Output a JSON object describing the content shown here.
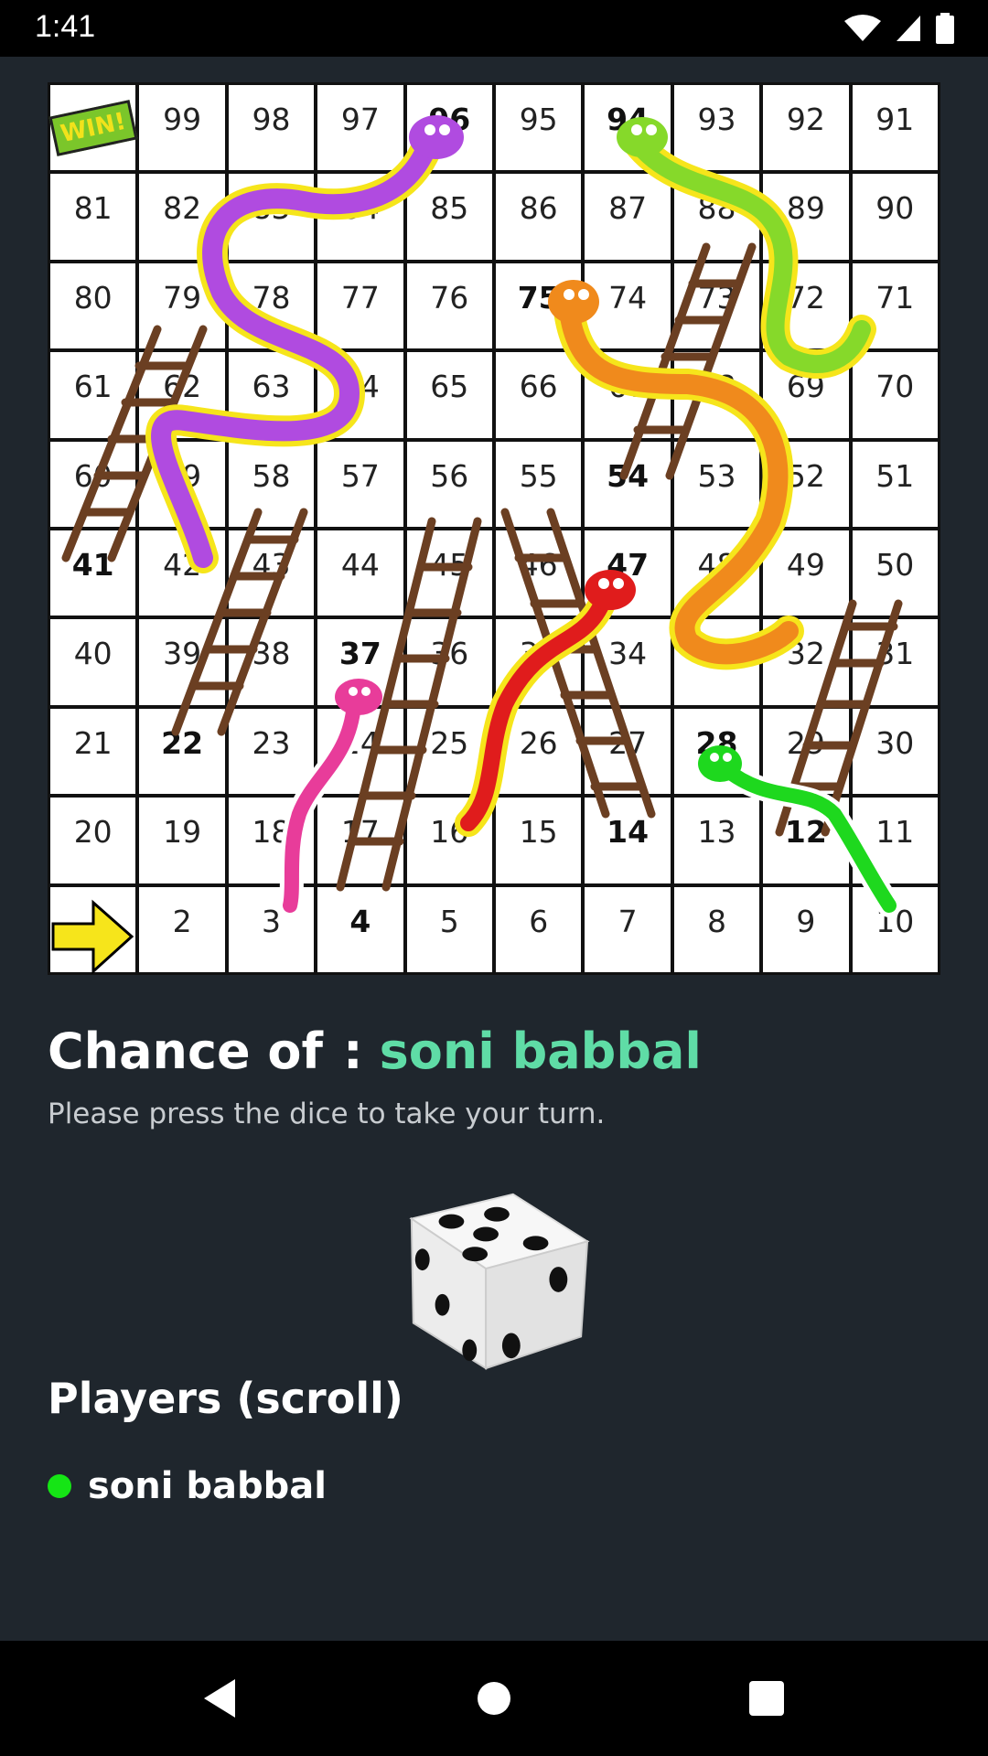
{
  "status_bar": {
    "time": "1:41"
  },
  "board": {
    "rows": [
      [
        "WIN!",
        "99",
        "98",
        "97",
        "96",
        "95",
        "94",
        "93",
        "92",
        "91"
      ],
      [
        "81",
        "82",
        "83",
        "84",
        "85",
        "86",
        "87",
        "88",
        "89",
        "90"
      ],
      [
        "80",
        "79",
        "78",
        "77",
        "76",
        "75",
        "74",
        "73",
        "72",
        "71"
      ],
      [
        "61",
        "62",
        "63",
        "64",
        "65",
        "66",
        "67",
        "68",
        "69",
        "70"
      ],
      [
        "60",
        "59",
        "58",
        "57",
        "56",
        "55",
        "54",
        "53",
        "52",
        "51"
      ],
      [
        "41",
        "42",
        "43",
        "44",
        "45",
        "46",
        "47",
        "48",
        "49",
        "50"
      ],
      [
        "40",
        "39",
        "38",
        "37",
        "36",
        "35",
        "34",
        "33",
        "32",
        "31"
      ],
      [
        "21",
        "22",
        "23",
        "24",
        "25",
        "26",
        "27",
        "28",
        "29",
        "30"
      ],
      [
        "20",
        "19",
        "18",
        "17",
        "16",
        "15",
        "14",
        "13",
        "12",
        "11"
      ],
      [
        "",
        "2",
        "3",
        "4",
        "5",
        "6",
        "7",
        "8",
        "9",
        "10"
      ]
    ],
    "bold_cells": [
      "96",
      "94",
      "75",
      "54",
      "41",
      "47",
      "37",
      "22",
      "28",
      "14",
      "12",
      "4"
    ],
    "win_label": "WIN!",
    "start_icon": "yellow-arrow-icon",
    "snake_colors": [
      "#b04be0",
      "#86d92a",
      "#f08a1c",
      "#e01c1c",
      "#e83c9a",
      "#1ed81e"
    ],
    "ladder_color": "#6b3f22"
  },
  "chance": {
    "label": "Chance of",
    "separator": ":",
    "player": "soni babbal"
  },
  "hint": "Please press the dice to take your turn.",
  "dice_icon": "dice-five-icon",
  "players": {
    "title": "Players (scroll)",
    "list": [
      {
        "name": "soni babbal",
        "color": "#15e515"
      }
    ]
  },
  "nav": {
    "back": "back-icon",
    "home": "home-icon",
    "recents": "recents-icon"
  }
}
